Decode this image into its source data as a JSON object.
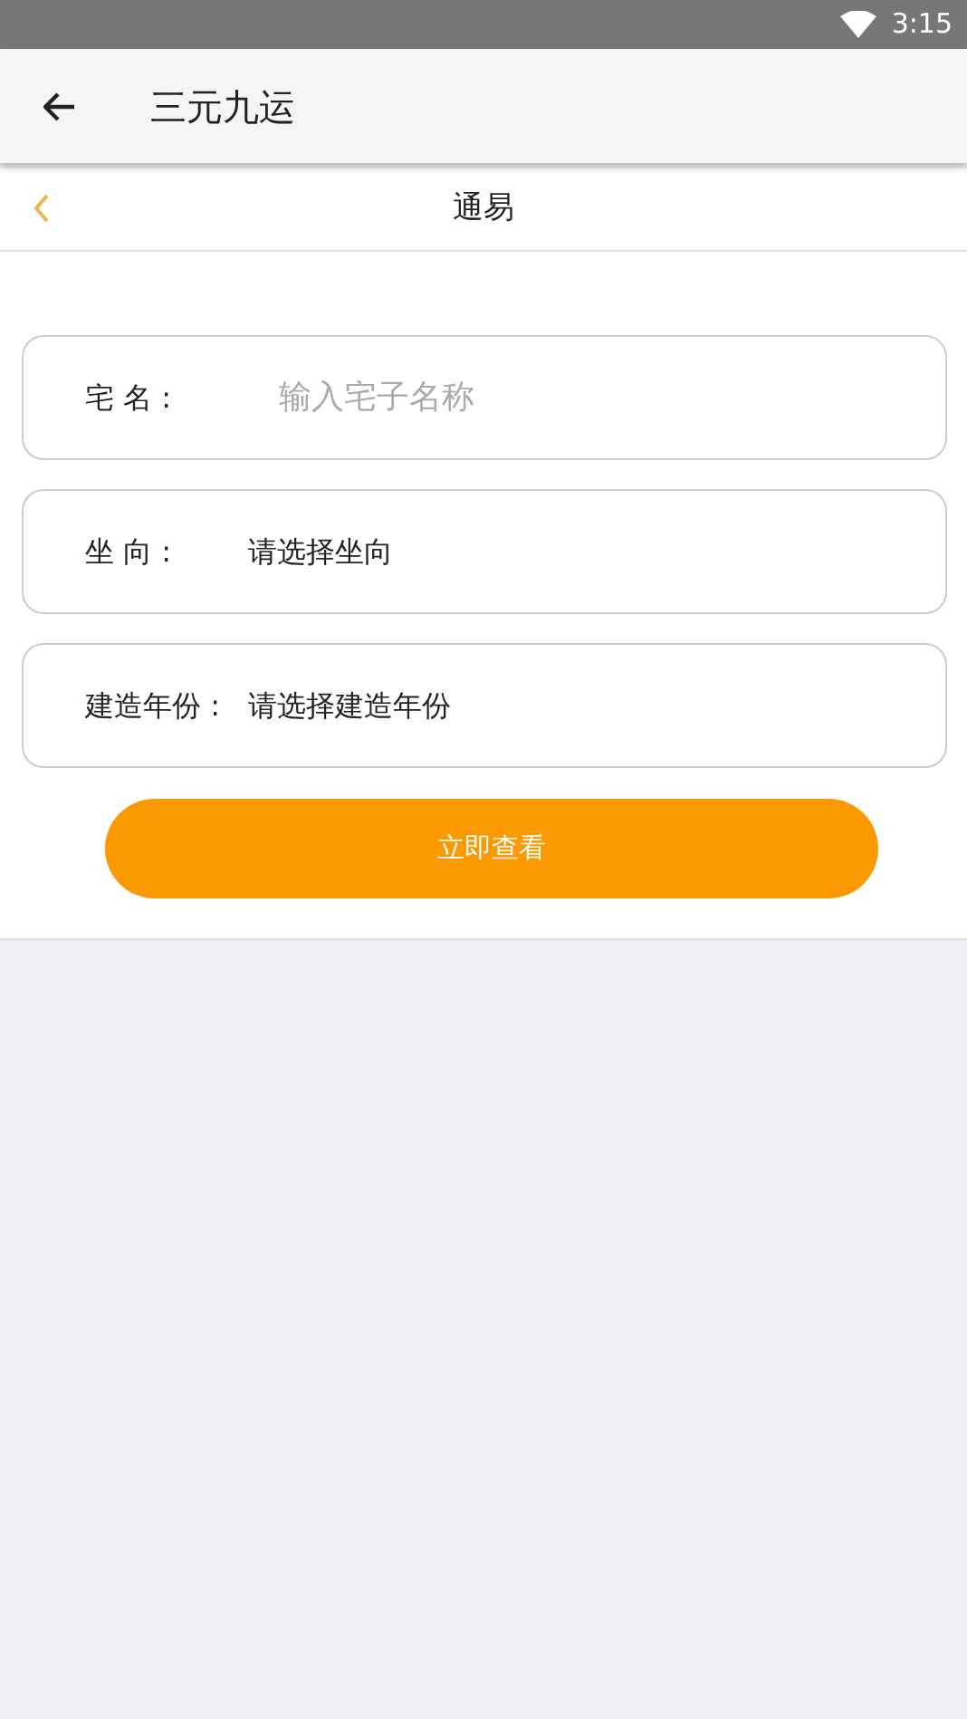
{
  "status_bar": {
    "time": "3:15"
  },
  "app_bar": {
    "title": "三元九运"
  },
  "sub_header": {
    "title": "通易"
  },
  "fields": [
    {
      "kind": "input",
      "label": "宅 名 :",
      "placeholder": "输入宅子名称"
    },
    {
      "kind": "select",
      "label": "坐 向 :",
      "value": "请选择坐向"
    },
    {
      "kind": "select",
      "label": "建造年份 :",
      "value": "请选择建造年份"
    }
  ],
  "submit_button": {
    "label": "立即查看"
  }
}
